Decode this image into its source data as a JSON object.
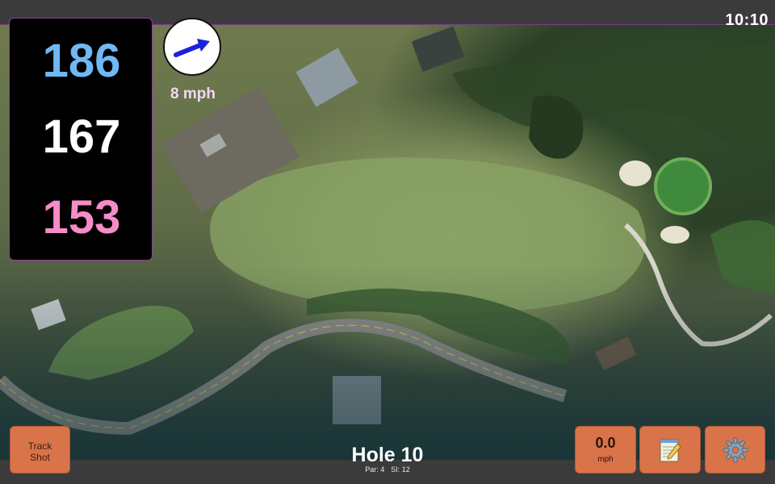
{
  "status": {
    "time": "10:10"
  },
  "distances": {
    "back": "186",
    "middle": "167",
    "front": "153"
  },
  "wind": {
    "speed": "8 mph",
    "icon": "wind-direction-arrow-icon"
  },
  "hole": {
    "title": "Hole 10",
    "par": "Par: 4",
    "stroke_index": "SI: 12"
  },
  "buttons": {
    "track_shot_line1": "Track",
    "track_shot_line2": "Shot",
    "speed_value": "0.0",
    "speed_unit": "mph",
    "notes_icon": "notepad-icon",
    "settings_icon": "gear-icon"
  },
  "colors": {
    "back_distance": "#6fb8f5",
    "middle_distance": "#ffffff",
    "front_distance": "#f58cc8",
    "button_bg": "#d9734a",
    "panel_border": "#8a3fa0"
  }
}
